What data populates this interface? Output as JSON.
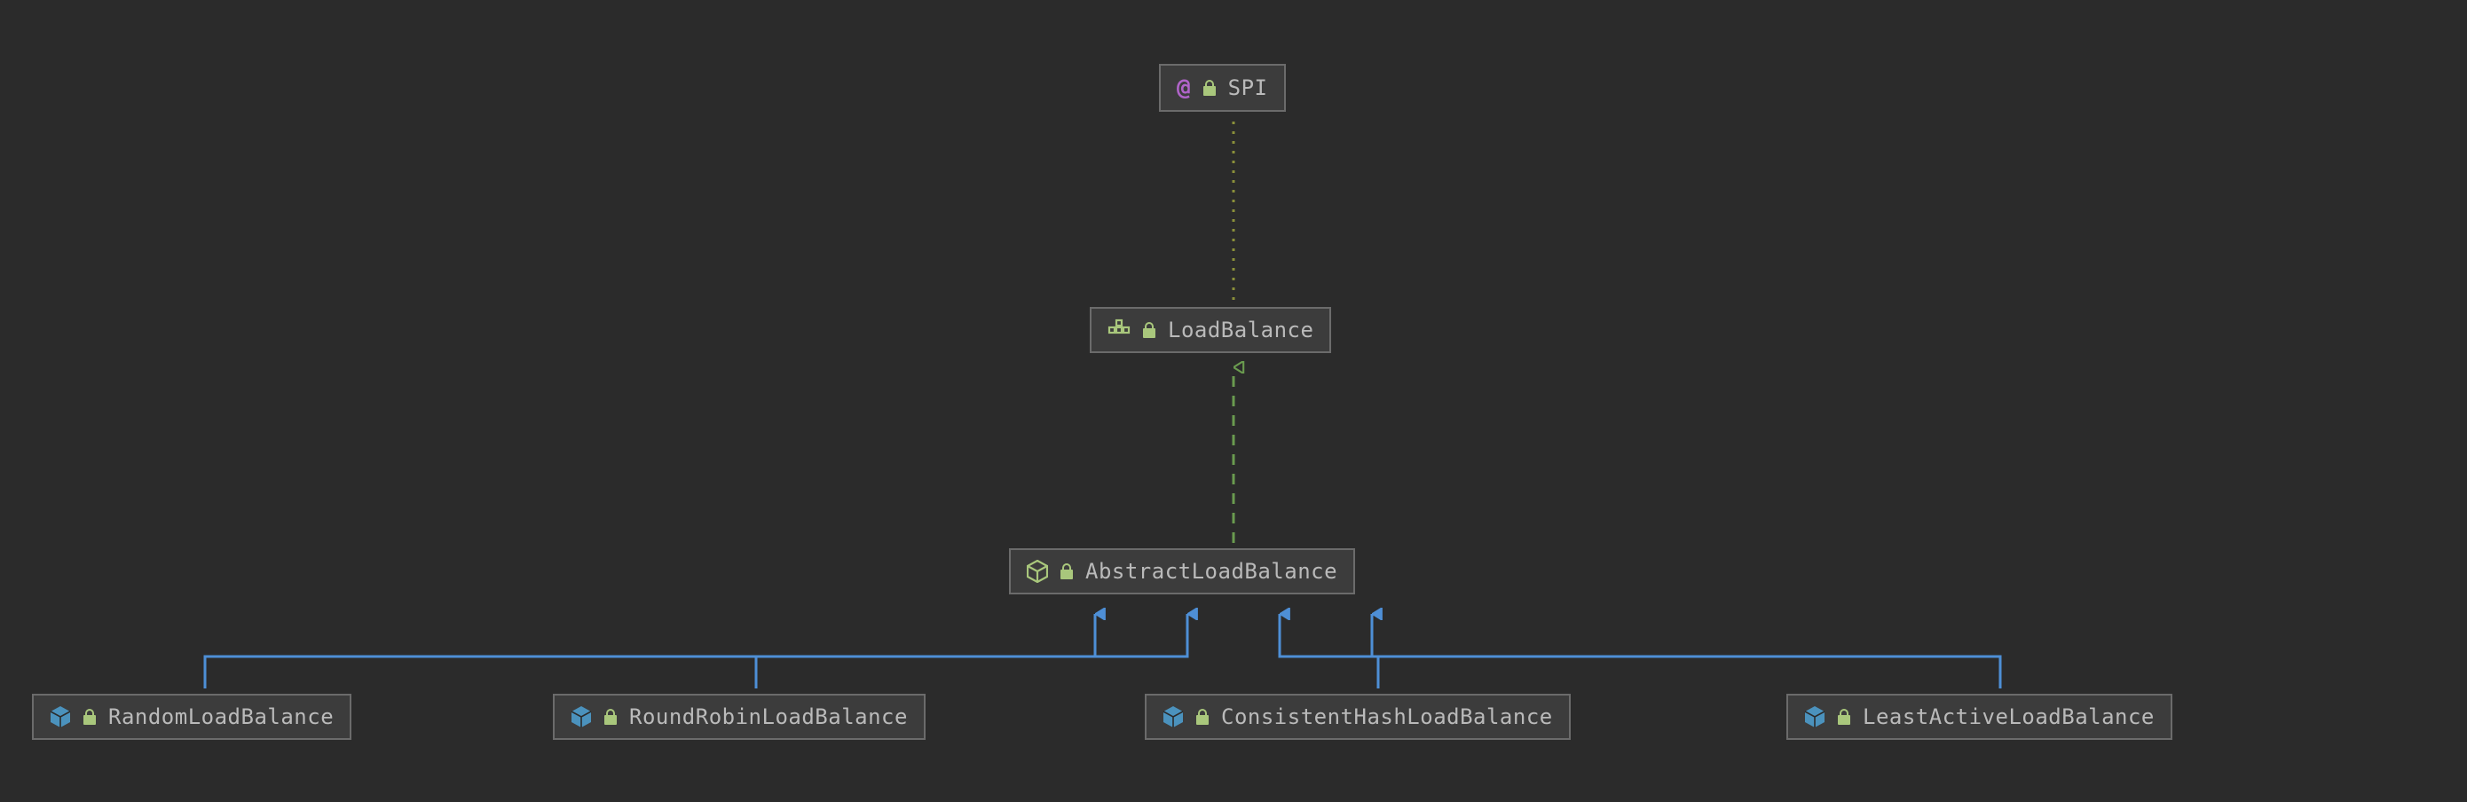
{
  "diagram": {
    "nodes": {
      "spi": {
        "label": "SPI",
        "icon": "annotation-icon",
        "lock": true
      },
      "lb": {
        "label": "LoadBalance",
        "icon": "interface-icon",
        "lock": true
      },
      "abs": {
        "label": "AbstractLoadBalance",
        "icon": "abstract-class-icon",
        "lock": true
      },
      "random": {
        "label": "RandomLoadBalance",
        "icon": "class-icon",
        "lock": true
      },
      "rr": {
        "label": "RoundRobinLoadBalance",
        "icon": "class-icon",
        "lock": true
      },
      "chash": {
        "label": "ConsistentHashLoadBalance",
        "icon": "class-icon",
        "lock": true
      },
      "leastact": {
        "label": "LeastActiveLoadBalance",
        "icon": "class-icon",
        "lock": true
      }
    },
    "edges": [
      {
        "from": "lb",
        "to": "spi",
        "style": "dotted",
        "color": "#8a8f3a",
        "arrow": "none"
      },
      {
        "from": "abs",
        "to": "lb",
        "style": "dashed",
        "color": "#6a9b4f",
        "arrow": "hollow"
      },
      {
        "from": "random",
        "to": "abs",
        "style": "solid",
        "color": "#4e8fd6",
        "arrow": "filled"
      },
      {
        "from": "rr",
        "to": "abs",
        "style": "solid",
        "color": "#4e8fd6",
        "arrow": "filled"
      },
      {
        "from": "chash",
        "to": "abs",
        "style": "solid",
        "color": "#4e8fd6",
        "arrow": "filled"
      },
      {
        "from": "leastact",
        "to": "abs",
        "style": "solid",
        "color": "#4e8fd6",
        "arrow": "filled"
      }
    ]
  }
}
